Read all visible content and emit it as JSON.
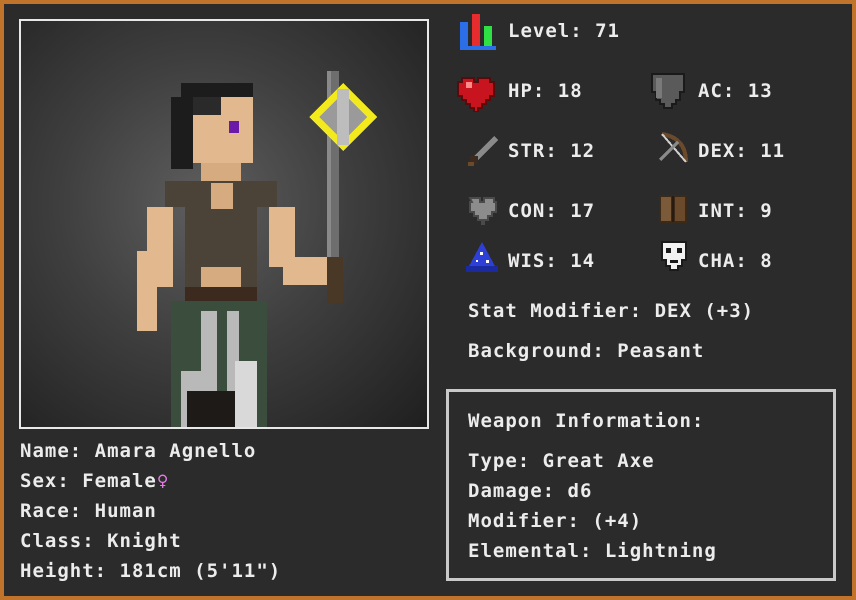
{
  "level": {
    "label": "Level:",
    "value": "71"
  },
  "stats": {
    "hp": {
      "label": "HP:",
      "value": "18",
      "icon": "heart-icon"
    },
    "ac": {
      "label": "AC:",
      "value": "13",
      "icon": "shield-icon"
    },
    "str": {
      "label": "STR:",
      "value": "12",
      "icon": "sword-icon"
    },
    "dex": {
      "label": "DEX:",
      "value": "11",
      "icon": "bow-icon"
    },
    "con": {
      "label": "CON:",
      "value": "17",
      "icon": "grey-heart-icon"
    },
    "int": {
      "label": "INT:",
      "value": "9",
      "icon": "book-icon"
    },
    "wis": {
      "label": "WIS:",
      "value": "14",
      "icon": "wizard-hat-icon"
    },
    "cha": {
      "label": "CHA:",
      "value": "8",
      "icon": "mask-icon"
    }
  },
  "stat_modifier": "Stat Modifier: DEX (+3)",
  "background": "Background: Peasant",
  "weapon": {
    "heading": "Weapon Information:",
    "type": "Type: Great Axe",
    "damage": "Damage: d6",
    "modifier": "Modifier: (+4)",
    "elemental": "Elemental: Lightning"
  },
  "character": {
    "name": "Name: Amara Agnello",
    "sex": "Sex: Female",
    "sex_symbol": "♀",
    "race": "Race: Human",
    "class": "Class: Knight",
    "height": "Height: 181cm (5'11\")"
  },
  "colors": {
    "frame": "#c0732a",
    "panel": "#2b2b2b",
    "text": "#ececec",
    "female": "#e87be8"
  }
}
